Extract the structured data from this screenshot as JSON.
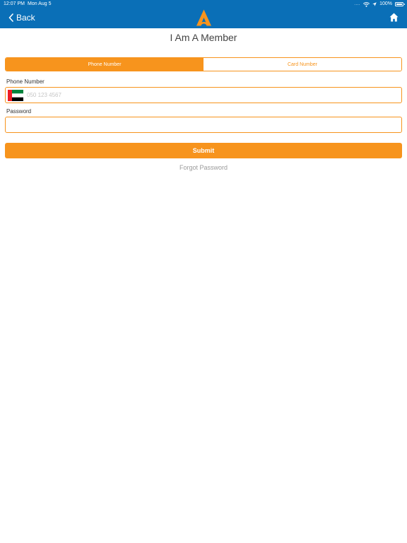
{
  "status_bar": {
    "time": "12:07 PM",
    "date": "Mon Aug 5",
    "signal": "....",
    "battery": "100%"
  },
  "nav": {
    "back_label": "Back",
    "logo_icon": "brand-logo",
    "home_icon": "home-icon"
  },
  "page": {
    "title": "I Am A Member"
  },
  "tabs": [
    {
      "label": "Phone Number",
      "selected": true
    },
    {
      "label": "Card Number",
      "selected": false
    }
  ],
  "form": {
    "phone_label": "Phone Number",
    "phone_placeholder": "050 123 4567",
    "phone_value": "",
    "country_flag": "uae-flag-icon",
    "password_label": "Password",
    "password_value": "",
    "submit_label": "Submit",
    "forgot_label": "Forgot Password"
  },
  "colors": {
    "nav_bg": "#0a6fb7",
    "accent": "#f7941d"
  }
}
